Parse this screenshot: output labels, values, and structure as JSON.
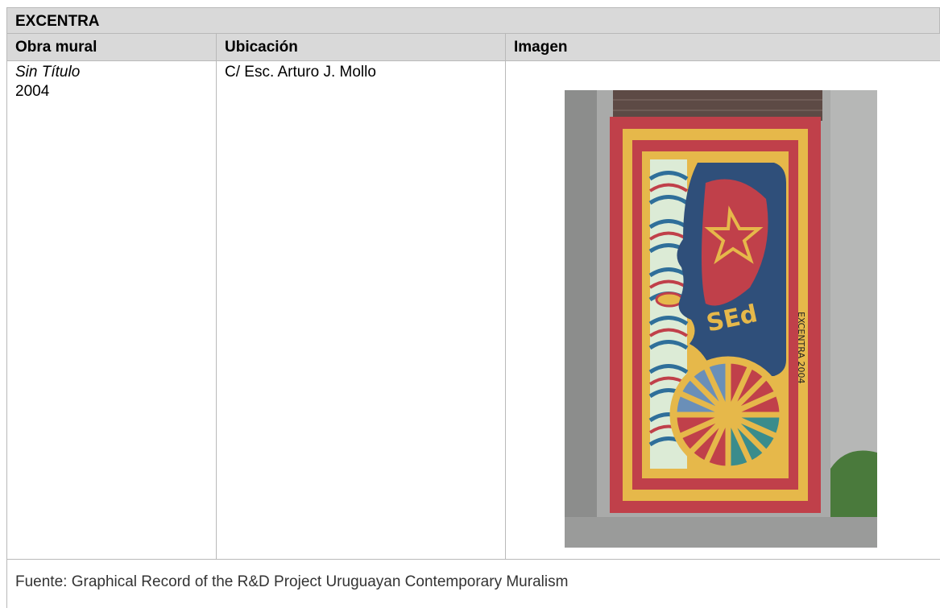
{
  "table": {
    "artist": "EXCENTRA",
    "headers": {
      "col1": "Obra mural",
      "col2": "Ubicación",
      "col3": "Imagen"
    },
    "row": {
      "title": "Sin Título",
      "year": "2004",
      "location": "C/  Esc. Arturo J. Mollo"
    },
    "footer": "Fuente: Graphical Record of the R&D Project Uruguayan Contemporary Muralism"
  },
  "photo": {
    "signature": "EXCENTRA 2004",
    "mural_text": "SEd",
    "colors": {
      "wall": "#a9aaa9",
      "red": "#c0404a",
      "yellow": "#e6b84a",
      "blue": "#2f4f7a"
    }
  }
}
